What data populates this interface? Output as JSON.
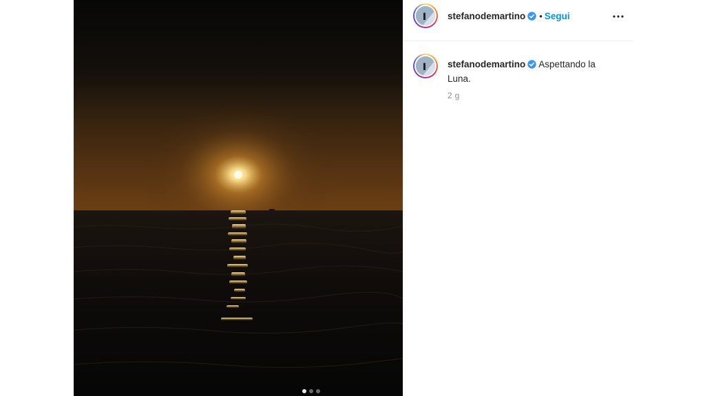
{
  "post": {
    "username": "stefanodemartino",
    "follow_label": "Segui",
    "separator": "•",
    "caption": "Aspettando la Luna.",
    "time_ago": "2 g",
    "verified": true
  },
  "carousel": {
    "total_slides": 3,
    "current_slide": 1
  },
  "icons": {
    "verified": "verified-badge-icon",
    "more": "more-options-icon",
    "next": "chevron-right-icon"
  },
  "colors": {
    "follow": "#0095f6",
    "verified": "#3897f0",
    "text": "#262626",
    "muted": "#8e8e8e"
  }
}
